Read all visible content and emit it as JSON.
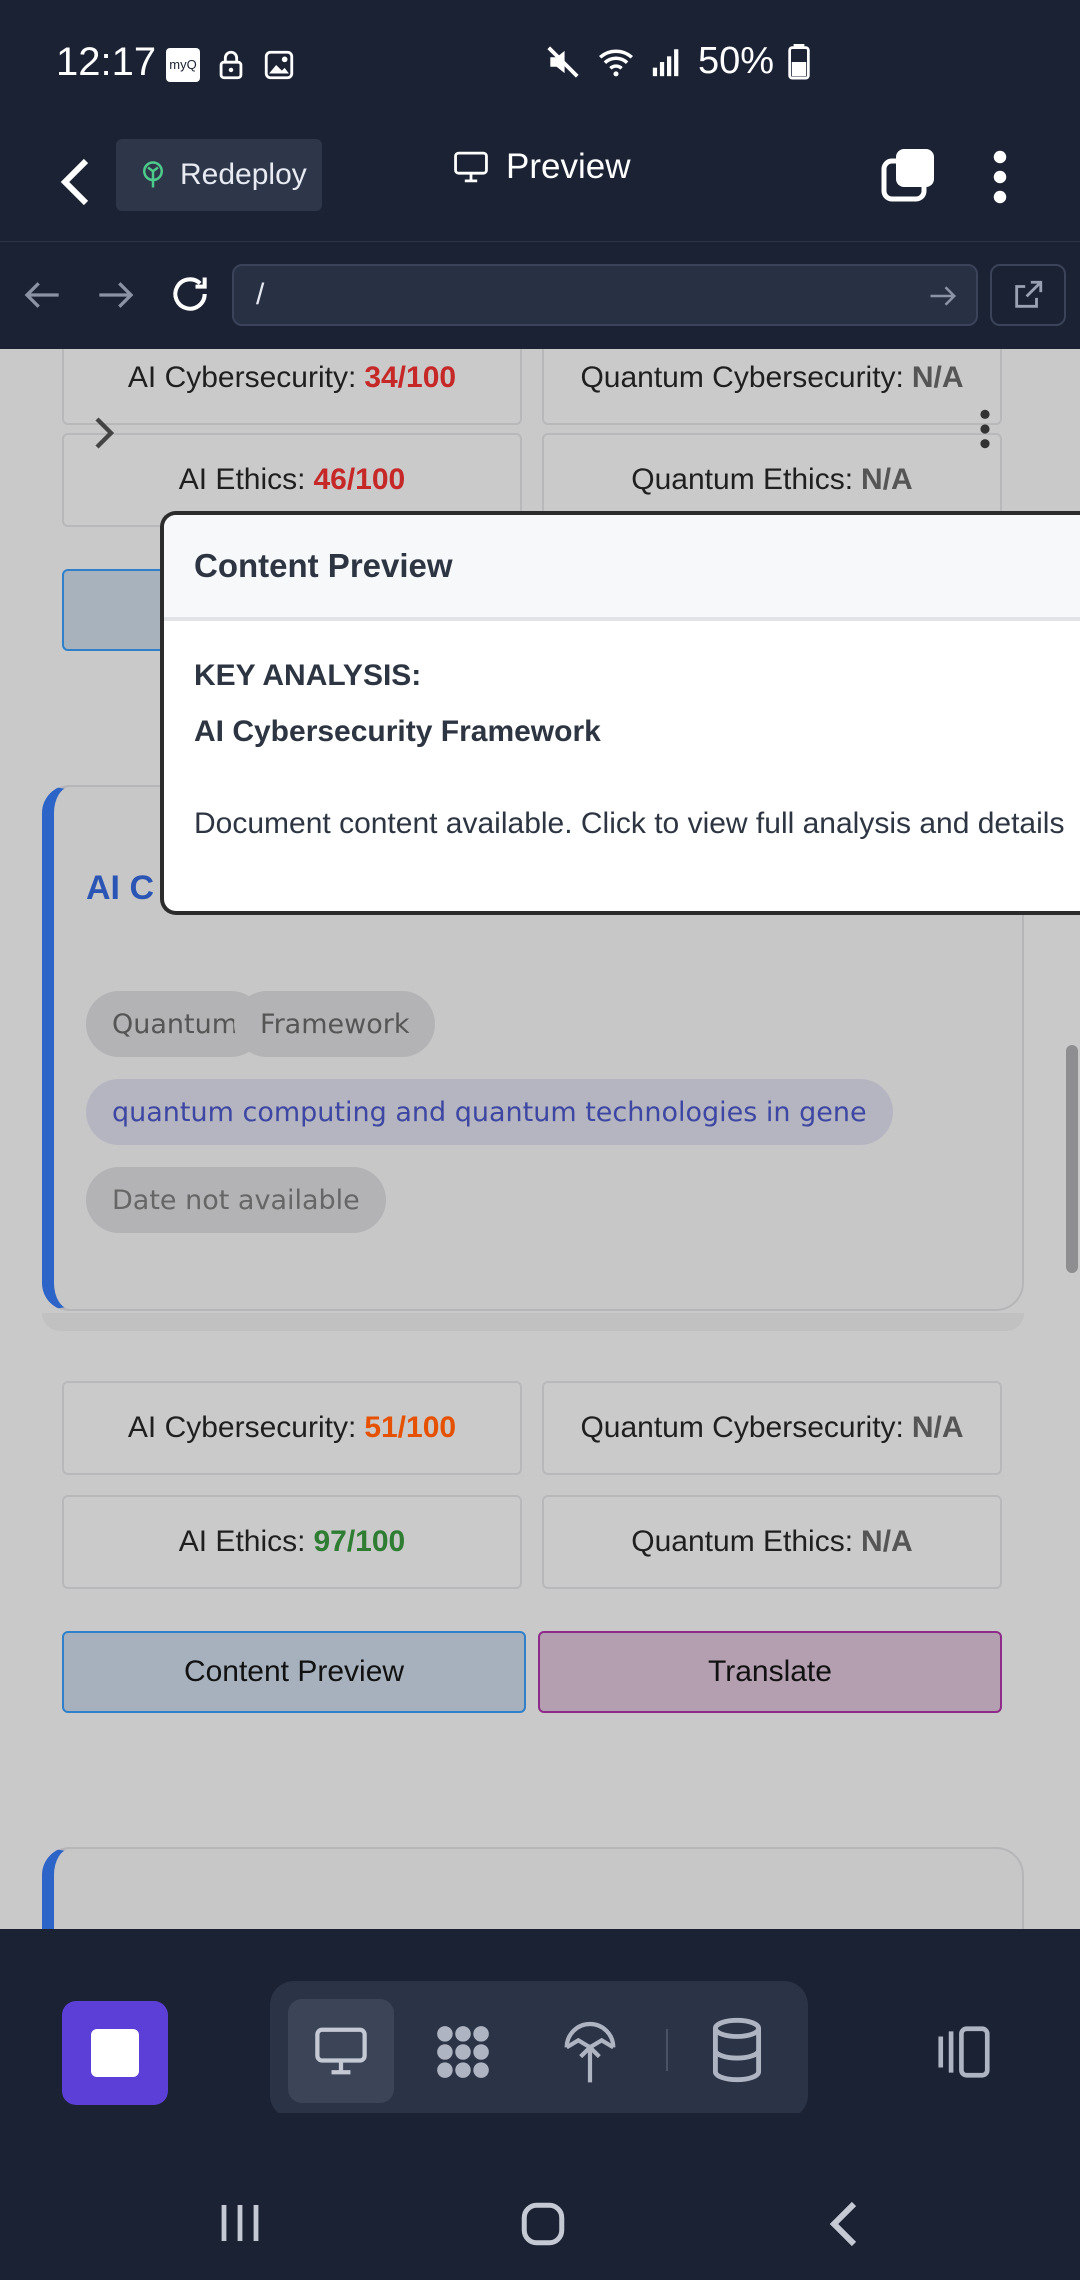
{
  "status_bar": {
    "time": "12:17",
    "battery": "50%"
  },
  "app_header": {
    "redeploy_label": "Redeploy",
    "title": "Preview"
  },
  "url_bar": {
    "value": "/"
  },
  "score_rows_top": [
    {
      "left_label": "AI Cybersecurity:",
      "left_value": "34/100",
      "left_color": "#c62828",
      "right_label": "Quantum Cybersecurity:",
      "right_value": "N/A"
    },
    {
      "left_label": "AI Ethics:",
      "left_value": "46/100",
      "left_color": "#c62828",
      "right_label": "Quantum Ethics:",
      "right_value": "N/A"
    }
  ],
  "card": {
    "title": "AI C",
    "tags": [
      "Quantum",
      "Framework"
    ],
    "topic": "quantum computing and quantum technologies in gene",
    "date": "Date not available"
  },
  "score_rows_bottom": [
    {
      "left_label": "AI Cybersecurity:",
      "left_value": "51/100",
      "left_color": "#e65100",
      "right_label": "Quantum Cybersecurity:",
      "right_value": "N/A"
    },
    {
      "left_label": "AI Ethics:",
      "left_value": "97/100",
      "left_color": "#2e7d32",
      "right_label": "Quantum Ethics:",
      "right_value": "N/A"
    }
  ],
  "actions": {
    "content_preview": "Content Preview",
    "translate": "Translate"
  },
  "modal": {
    "title": "Content Preview",
    "heading": "KEY ANALYSIS:",
    "subheading": "AI Cybersecurity Framework",
    "body": "Document content available. Click to view full analysis and details"
  },
  "colors": {
    "accent": "#5b3fd6",
    "background": "#1b2233",
    "card_border": "#2d64c7"
  }
}
